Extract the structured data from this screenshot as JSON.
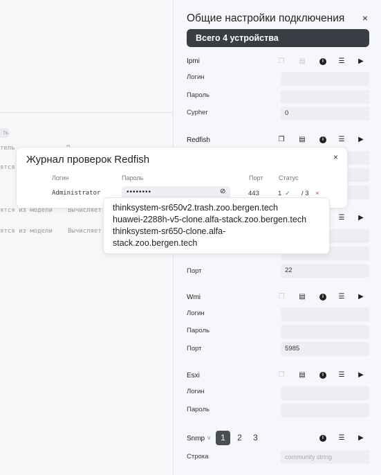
{
  "background": {
    "chip_text": "ть",
    "rows": [
      {
        "left": "тель",
        "right": "П...."
      },
      {
        "left": "ятся из модели",
        "right": ""
      },
      {
        "left": "ятся из модели",
        "right": "Вычисляет"
      },
      {
        "left": "ятся из модели",
        "right": "Вычисляет"
      }
    ]
  },
  "panel": {
    "title": "Общие настройки подключения",
    "close_icon": "×",
    "device_count_label": "Всего 4 устройства",
    "sections": {
      "ipmi": {
        "name": "Ipmi",
        "login_label": "Логин",
        "password_label": "Пароль",
        "cypher_label": "Cypher",
        "cypher_value": "0"
      },
      "redfish": {
        "name": "Redfish"
      },
      "ssh": {
        "port_label": "Порт",
        "port_value": "22"
      },
      "wmi": {
        "name": "Wmi",
        "login_label": "Логин",
        "password_label": "Пароль",
        "port_label": "Порт",
        "port_value": "5985"
      },
      "esxi": {
        "name": "Esxi",
        "login_label": "Логин",
        "password_label": "Пароль"
      },
      "snmp": {
        "name": "Snmp",
        "version_marker": "v",
        "versions": [
          "1",
          "2",
          "3"
        ],
        "string_label": "Строка",
        "string_placeholder": "community string"
      }
    }
  },
  "journal": {
    "title": "Журнал проверок Redfish",
    "close_icon": "×",
    "headers": {
      "login": "Логин",
      "password": "Пароль",
      "port": "Порт",
      "status": "Статус"
    },
    "row": {
      "login": "Administrator",
      "password": "••••••••",
      "port": "443",
      "ok_count": "1",
      "ok_mark": "✓",
      "total": "/ 3",
      "fail_mark": "×"
    }
  },
  "tooltip": {
    "lines": [
      "thinksystem-sr650v2.trash.zoo.bergen.tech",
      "huawei-2288h-v5-clone.alfa-stack.zoo.bergen.tech",
      "thinksystem-sr650-clone.alfa-",
      "stack.zoo.bergen.tech"
    ]
  },
  "colors": {
    "accent_dark": "#3a3d44",
    "ok": "#2e9b3a",
    "fail": "#d23a3a"
  }
}
